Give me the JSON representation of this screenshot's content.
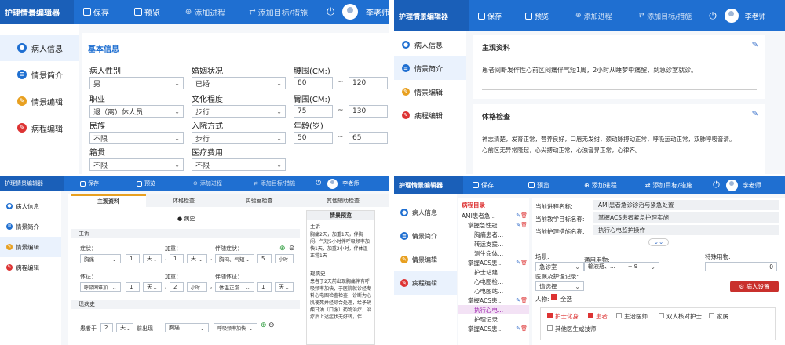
{
  "app": {
    "title": "护理情景编辑器",
    "save": "保存",
    "preview": "预览",
    "add_process": "添加进程",
    "add_goal": "添加目标/措施",
    "user": "李老师"
  },
  "sidebar": [
    "病人信息",
    "情景简介",
    "情景编辑",
    "病程编辑"
  ],
  "p1": {
    "section": "基本信息",
    "gender_label": "病人性别",
    "gender": "男",
    "job_label": "职业",
    "job": "退（离）休人员",
    "ethnic_label": "民族",
    "ethnic": "不限",
    "native_label": "籍贯",
    "native": "不限",
    "marital_label": "婚姻状况",
    "marital": "已婚",
    "edu_label": "文化程度",
    "edu": "步行",
    "admit_label": "入院方式",
    "admit": "步行",
    "cost_label": "医疗费用",
    "cost": "不限",
    "waist_label": "腰围(CM:)",
    "waist_min": "80",
    "waist_max": "120",
    "hip_label": "臀围(CM:)",
    "hip_min": "75",
    "hip_max": "130",
    "age_label": "年龄(岁)",
    "age_min": "50",
    "age_max": "65",
    "tilde": "~"
  },
  "p2": {
    "card1_title": "主观资料",
    "card1_text": "患者间断发作性心前区闷痛伴气短1周，2小时从睡梦中痛醒，到急诊室就诊。",
    "card2_title": "体格检查",
    "card2_text1": "神志清楚，发育正常，营养良好，口唇无发绀，颈动脉搏动正常，呼吸运动正常，双肺呼吸音清。",
    "card2_text2": "心前区无异常隆起，心尖搏动正常，心浊音界正常，心律齐。"
  },
  "p3": {
    "tabs": [
      "主观资料",
      "体格检查",
      "实验室检查",
      "其他辅助检查"
    ],
    "disease": "● 病史",
    "chief": "主诉",
    "symptom_label": "症状：",
    "symptom": "胸痛",
    "add_label": "加重：",
    "add_dur": "1",
    "unit_day": "天",
    "accomp_label": "伴随症状：",
    "accomp": "胸闷、气短",
    "accomp_num": "5",
    "unit_hour": "小时",
    "sign_label": "体征：",
    "sign": "呼吸困难加",
    "sign_num": "2",
    "unit_hour2": "小时",
    "accomp_sign_label": "伴随体征：",
    "accomp_sign": "体温正常",
    "accomp_sign_num": "1",
    "unit_day2": "天",
    "hpi": "现病史",
    "patient_prefix": "患者于",
    "patient_num": "2",
    "patient_unit": "天",
    "patient_mid": "前出现",
    "patient_sym": "胸痛",
    "patient_sym2": "呼吸频率加快",
    "preview_title": "情景预览",
    "preview_chief_label": "主诉",
    "preview_chief": "胸痛2天，加重1天，伴胸闷、气短5小时伴呼吸频率加快1天，加重2小时，伴体温正常1天",
    "preview_hpi_label": "现病史",
    "preview_hpi": "患者于2天前出现胸痛伴有呼吸频率加快，于医院就诊经专科心电图检查检查，诊断为心肌梗死并经综合处理，给予硝酸甘油（口服）药物治疗，治疗后上述症状无好转，伴"
  },
  "p4": {
    "dir_title": "病程目录",
    "tree": [
      "AMI患者急...",
      "掌握急性冠...",
      "胸痛患者...",
      "转运支援...",
      "测生命体...",
      "掌握ACS患...",
      "护士站建...",
      "心电图检...",
      "心电图站...",
      "掌握ACS患...",
      "执行心电...",
      "护理记录",
      "掌握ACS患..."
    ],
    "proc_label": "当前进程名称:",
    "proc": "AMI患者急诊诊治与紧急处置",
    "goal_label": "当前教学目标名称:",
    "goal": "掌握ACS患者紧急护理实施",
    "measure_label": "当前护理措施名称:",
    "measure": "执行心电监护操作",
    "scene_label": "场景:",
    "scene": "急诊室",
    "common_label": "通用用物:",
    "common": "输液瓶、...",
    "common_num": "+ 9",
    "special_label": "特殊用物:",
    "special": "0",
    "record_label": "医嘱及护理记录:",
    "record": "请选择",
    "person_label": "人物:",
    "all": "全选",
    "people": [
      "护士化身",
      "患者",
      "主治医师",
      "双人核对护士",
      "家属",
      "其他医生或技师"
    ],
    "settings": "病人设置"
  },
  "colors": {
    "brand": "#1f6fd1",
    "accent": "#d33"
  }
}
